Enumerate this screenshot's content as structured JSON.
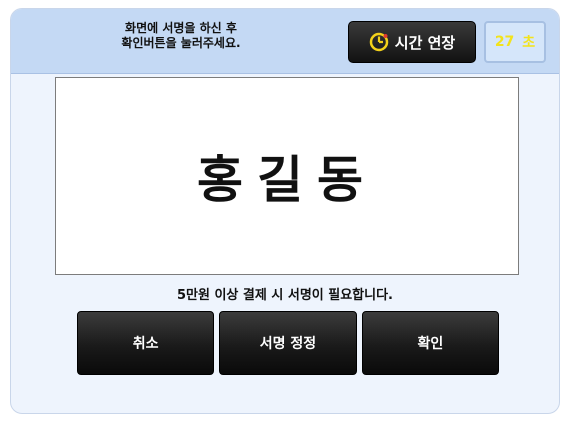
{
  "header": {
    "instruction_line1": "화면에 서명을 하신 후",
    "instruction_line2": "확인버튼을 눌러주세요.",
    "extend_button_label": "시간 연장",
    "timer_value": "27",
    "timer_unit": "초",
    "extend_icon": "clock-icon"
  },
  "signature": {
    "name": "홍길동"
  },
  "notice": "5만원 이상 결제 시 서명이 필요합니다.",
  "actions": {
    "cancel_label": "취소",
    "correct_label": "서명 정정",
    "confirm_label": "확인"
  },
  "colors": {
    "header_bg": "#c4d9f4",
    "panel_bg": "#eef4fd",
    "timer_text": "#f2e31c",
    "clock_accent": "#f3d11a",
    "button_bg": "#1a1a1a"
  }
}
